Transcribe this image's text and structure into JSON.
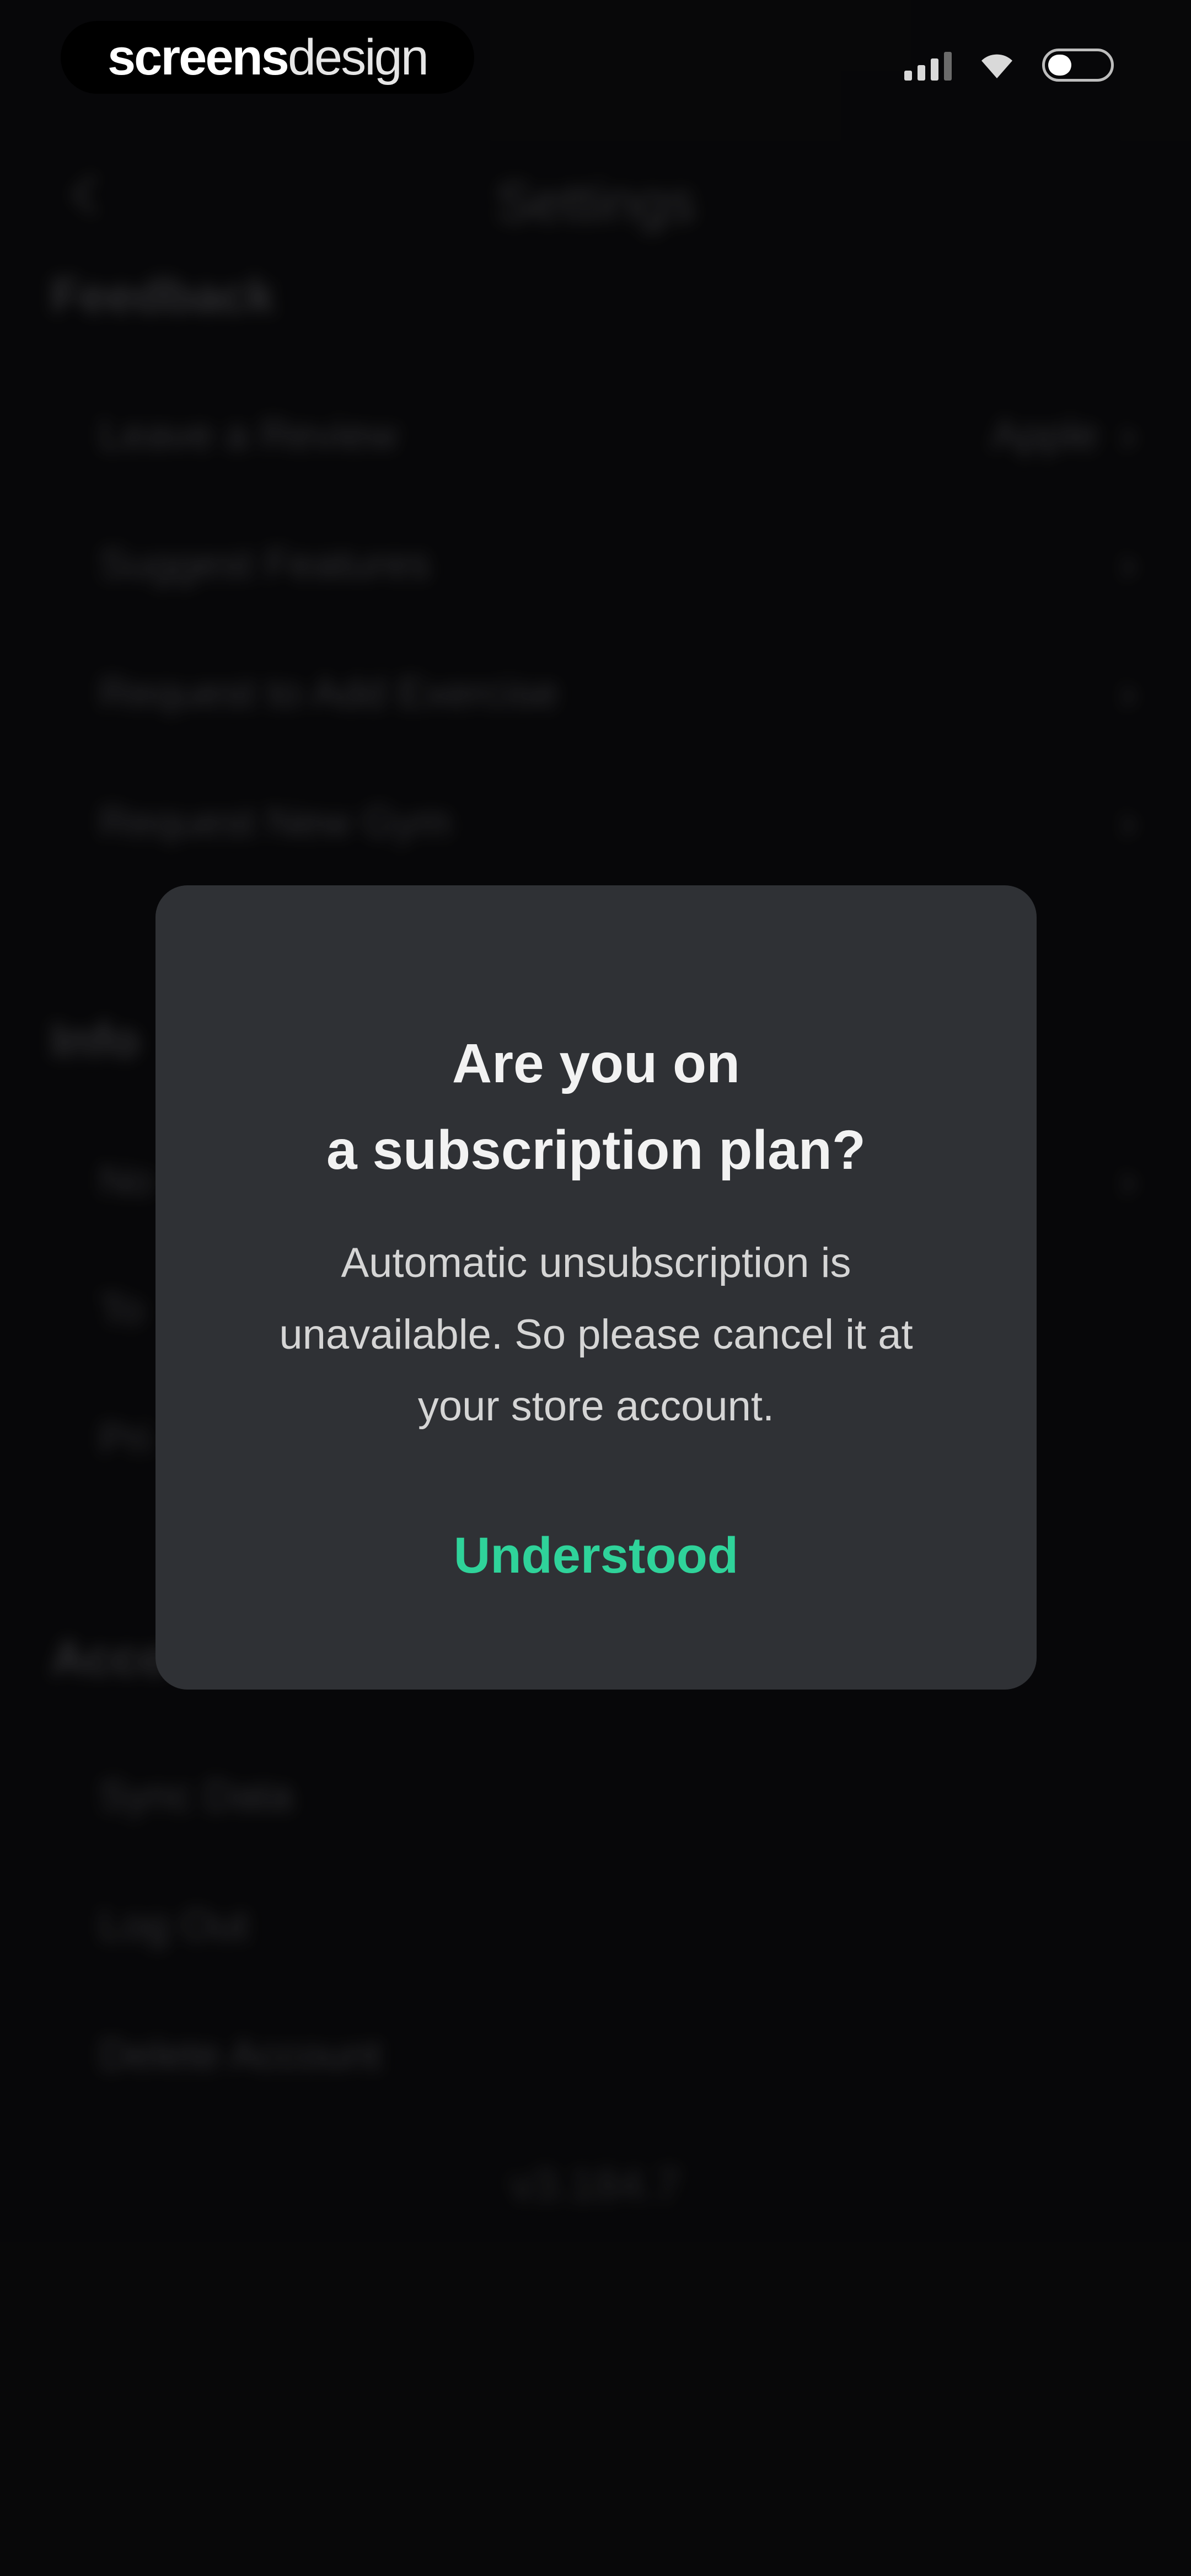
{
  "status_bar": {
    "brand_bold": "screens",
    "brand_light": "design"
  },
  "nav": {
    "title": "Settings"
  },
  "sections": {
    "feedback": {
      "title": "Feedback",
      "rows": [
        {
          "label": "Leave a Review",
          "value": "Apple"
        },
        {
          "label": "Suggest Features",
          "value": ""
        },
        {
          "label": "Request to Add Exercise",
          "value": ""
        },
        {
          "label": "Request New Gym",
          "value": ""
        }
      ]
    },
    "info": {
      "title": "Info",
      "rows": [
        {
          "label": "No"
        },
        {
          "label": "To"
        },
        {
          "label": "Pri"
        }
      ]
    },
    "account": {
      "title": "Acco",
      "rows": [
        {
          "label": "Sync Data"
        },
        {
          "label": "Log Out"
        },
        {
          "label": "Delete Account"
        }
      ]
    }
  },
  "version": "v3.184.7",
  "dialog": {
    "title_line1": "Are you on",
    "title_line2": "a subscription plan?",
    "body_line1": "Automatic unsubscription is",
    "body_line2": "unavailable. So please cancel it at",
    "body_line3": "your store account.",
    "button": "Understood",
    "accent_color": "#2fd39a"
  },
  "icons": {
    "back": "chevron-left-icon",
    "row_chevron": "chevron-right-icon",
    "signal": "cellular-signal-icon",
    "wifi": "wifi-icon",
    "battery": "battery-icon"
  }
}
